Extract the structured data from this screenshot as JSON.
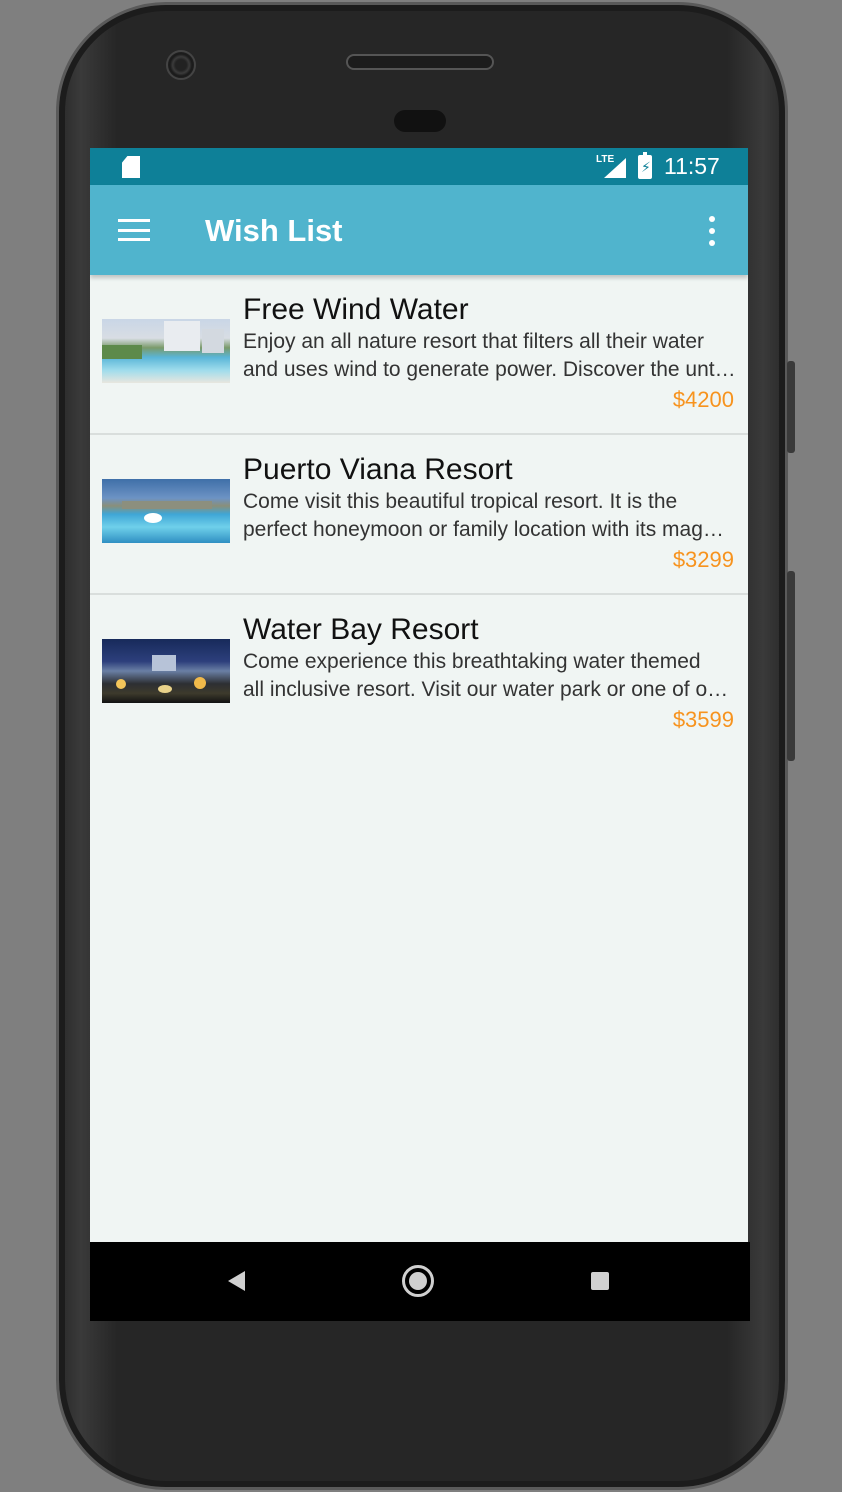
{
  "status_bar": {
    "network": "LTE",
    "time": "11:57",
    "icons": [
      "sd-card-icon",
      "lte-signal-icon",
      "battery-charging-icon"
    ]
  },
  "app_bar": {
    "title": "Wish List",
    "menu_icon": "hamburger-menu-icon",
    "overflow_icon": "more-vert-icon"
  },
  "items": [
    {
      "title": "Free Wind Water",
      "description_line1": "Enjoy an all nature resort that filters all their water",
      "description_line2": "and uses wind to generate power. Discover the unt…",
      "price": "$4200"
    },
    {
      "title": "Puerto Viana Resort",
      "description_line1": "Come visit this beautiful tropical resort. It is the",
      "description_line2": "perfect honeymoon or family location with its mag…",
      "price": "$3299"
    },
    {
      "title": "Water Bay Resort",
      "description_line1": "Come experience this breathtaking water themed",
      "description_line2": "all inclusive resort. Visit our water park or one of o…",
      "price": "$3599"
    }
  ],
  "colors": {
    "status_bar": "#0e8098",
    "app_bar": "#50b4cd",
    "price": "#f7931e",
    "background": "#f0f5f3"
  },
  "nav_bar": {
    "icons": [
      "back-icon",
      "home-icon",
      "recents-icon"
    ]
  }
}
